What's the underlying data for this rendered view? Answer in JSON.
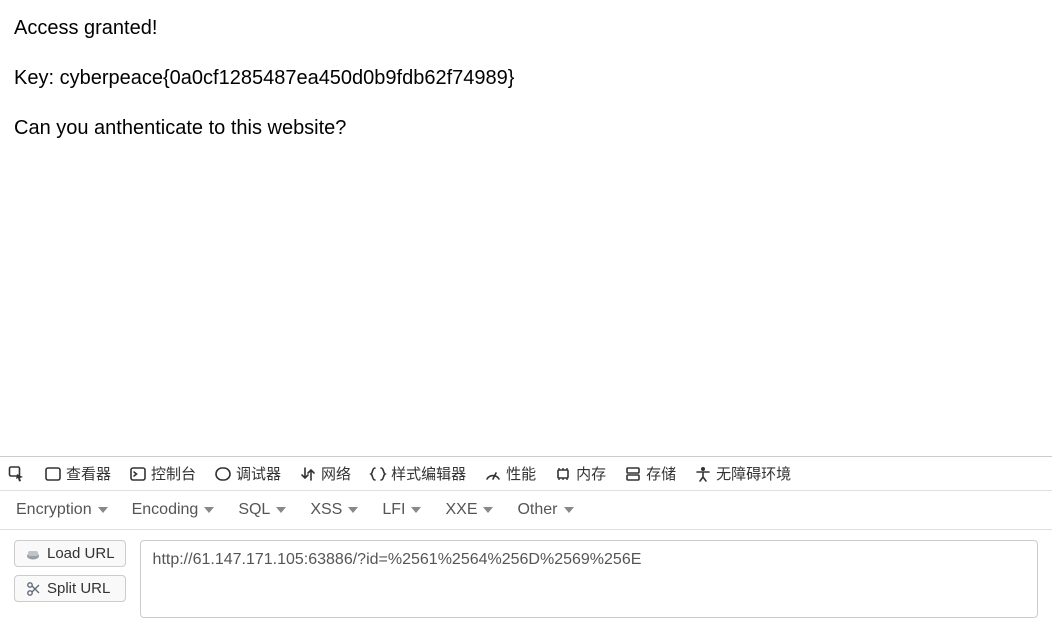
{
  "page": {
    "line1": "Access granted!",
    "line2": "Key: cyberpeace{0a0cf1285487ea450d0b9fdb62f74989}",
    "line3": "Can you anthenticate to this website?"
  },
  "devtools": {
    "tabs": {
      "inspector": "查看器",
      "console": "控制台",
      "debugger": "调试器",
      "network": "网络",
      "style_editor": "样式编辑器",
      "performance": "性能",
      "memory": "内存",
      "storage": "存储",
      "accessibility": "无障碍环境"
    }
  },
  "hackbar": {
    "dropdowns": {
      "encryption": "Encryption",
      "encoding": "Encoding",
      "sql": "SQL",
      "xss": "XSS",
      "lfi": "LFI",
      "xxe": "XXE",
      "other": "Other"
    },
    "buttons": {
      "load_url": "Load URL",
      "split_url": "Split URL"
    },
    "url_value": "http://61.147.171.105:63886/?id=%2561%2564%256D%2569%256E"
  }
}
